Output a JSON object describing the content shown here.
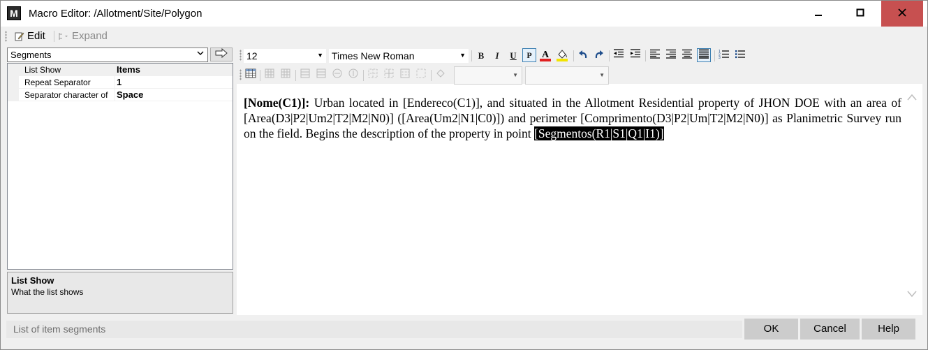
{
  "window": {
    "title": "Macro Editor: /Allotment/Site/Polygon",
    "app_icon_letter": "M"
  },
  "menu": {
    "edit_label": "Edit",
    "expand_label": "Expand"
  },
  "left_panel": {
    "segment_select": {
      "value": "Segments"
    },
    "properties": [
      {
        "name": "List Show",
        "value": "Items"
      },
      {
        "name": "Repeat Separator",
        "value": "1"
      },
      {
        "name": "Separator character of",
        "value": "Space"
      }
    ],
    "help": {
      "title": "List Show",
      "description": "What the list shows"
    }
  },
  "format_toolbar": {
    "font_size": "12",
    "font_name": "Times New Roman",
    "bold_label": "B",
    "italic_label": "I",
    "underline_label": "U",
    "p_label": "P",
    "font_color_label": "A",
    "colors": {
      "font_color": "#e02020",
      "highlight_color": "#f2e400",
      "active_border": "#3c7fb1"
    }
  },
  "document": {
    "segments": [
      {
        "text": "[Nome(C1)]:",
        "style": "bold"
      },
      {
        "text": " Urban located in [Endereco(C1)], and situated in the Allotment Residential property of JHON DOE with an area of [Area(D3|P2|Um2|T2|M2|N0)] ([Area(Um2|N1|C0)]) and perimeter [Comprimento(D3|P2|Um|T2|M2|N0)] as Planimetric Survey run on the field. Begins the description of the property in point ",
        "style": "normal"
      },
      {
        "text": "[Segmentos(R1|S1|Q1|I1)]",
        "style": "selected"
      }
    ]
  },
  "status": {
    "text": "List of item segments"
  },
  "buttons": {
    "ok": "OK",
    "cancel": "Cancel",
    "help": "Help"
  }
}
